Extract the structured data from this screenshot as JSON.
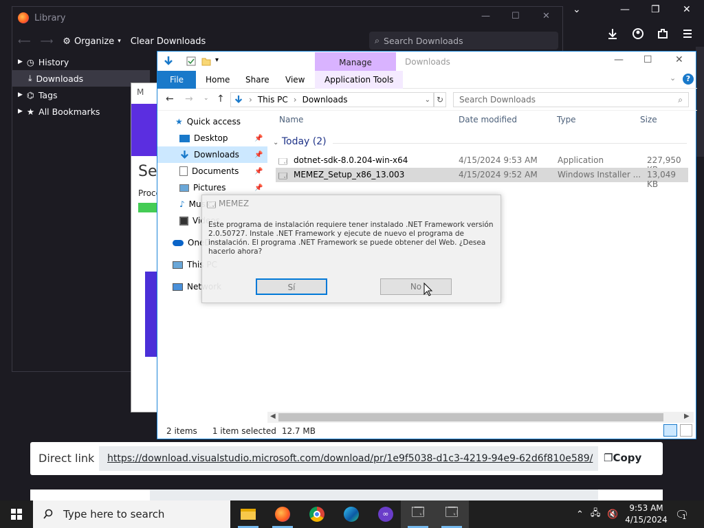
{
  "firefox": {
    "close_glyph": "✕",
    "restore_glyph": "❐",
    "min_glyph": "—",
    "chevron_glyph": "⌄"
  },
  "library": {
    "title": "Library",
    "organize": "Organize",
    "clear": "Clear Downloads",
    "search_placeholder": "Search Downloads",
    "sidebar": [
      {
        "label": "History",
        "icon": "clock-icon"
      },
      {
        "label": "Downloads",
        "icon": "download-icon",
        "selected": true
      },
      {
        "label": "Tags",
        "icon": "tag-icon"
      },
      {
        "label": "All Bookmarks",
        "icon": "star-icon"
      }
    ]
  },
  "setup": {
    "title_frag": "M",
    "heading_frag": "Set",
    "progress_frag": "Proce"
  },
  "explorer": {
    "manage": "Manage",
    "title": "Downloads",
    "tabs": {
      "file": "File",
      "home": "Home",
      "share": "Share",
      "view": "View",
      "apptools": "Application Tools"
    },
    "breadcrumb": [
      "This PC",
      "Downloads"
    ],
    "search_placeholder": "Search Downloads",
    "nav": [
      {
        "label": "Quick access",
        "icon": "star-icon"
      },
      {
        "label": "Desktop",
        "icon": "desktop-icon",
        "pinned": true
      },
      {
        "label": "Downloads",
        "icon": "download-icon",
        "pinned": true,
        "selected": true
      },
      {
        "label": "Documents",
        "icon": "document-icon",
        "pinned": true
      },
      {
        "label": "Pictures",
        "icon": "pictures-icon",
        "pinned": true
      },
      {
        "label": "Music",
        "icon": "music-icon"
      },
      {
        "label": "Videos",
        "icon": "video-icon"
      },
      {
        "label": "OneDrive",
        "icon": "cloud-icon"
      },
      {
        "label": "This PC",
        "icon": "computer-icon"
      },
      {
        "label": "Network",
        "icon": "network-icon"
      }
    ],
    "columns": [
      "Name",
      "Date modified",
      "Type",
      "Size"
    ],
    "group": "Today (2)",
    "files": [
      {
        "name": "dotnet-sdk-8.0.204-win-x64",
        "date": "4/15/2024 9:53 AM",
        "type": "Application",
        "size": "227,950 KB"
      },
      {
        "name": "MEMEZ_Setup_x86_13.003",
        "date": "4/15/2024 9:52 AM",
        "type": "Windows Installer ...",
        "size": "13,049 KB",
        "selected": true
      }
    ],
    "status": {
      "items": "2 items",
      "selected": "1 item selected",
      "size": "12.7 MB"
    }
  },
  "dialog": {
    "title": "MEMEZ",
    "message": "Este programa de instalación requiere tener instalado .NET Framework versión 2.0.50727. Instale .NET Framework y ejecute de nuevo el programa de instalación. El programa .NET Framework se puede obtener del Web. ¿Desea hacerlo ahora?",
    "yes": "Sí",
    "no": "No"
  },
  "direct_link": {
    "label": "Direct link",
    "url": "https://download.visualstudio.microsoft.com/download/pr/1e9f5038-d1c3-4219-94e9-62d6f810e589/",
    "copy": "Copy"
  },
  "taskbar": {
    "search_placeholder": "Type here to search",
    "time": "9:53 AM",
    "date": "4/15/2024",
    "notification_count": "1",
    "apps": [
      "file-explorer-icon",
      "firefox-icon",
      "chrome-icon",
      "edge-icon",
      "app-icon",
      "installer-icon",
      "installer-icon"
    ]
  },
  "colors": {
    "accent": "#1979ca",
    "manage": "#d9b3ff",
    "selected": "#cce8ff",
    "taskbar": "#1f1f1f"
  }
}
